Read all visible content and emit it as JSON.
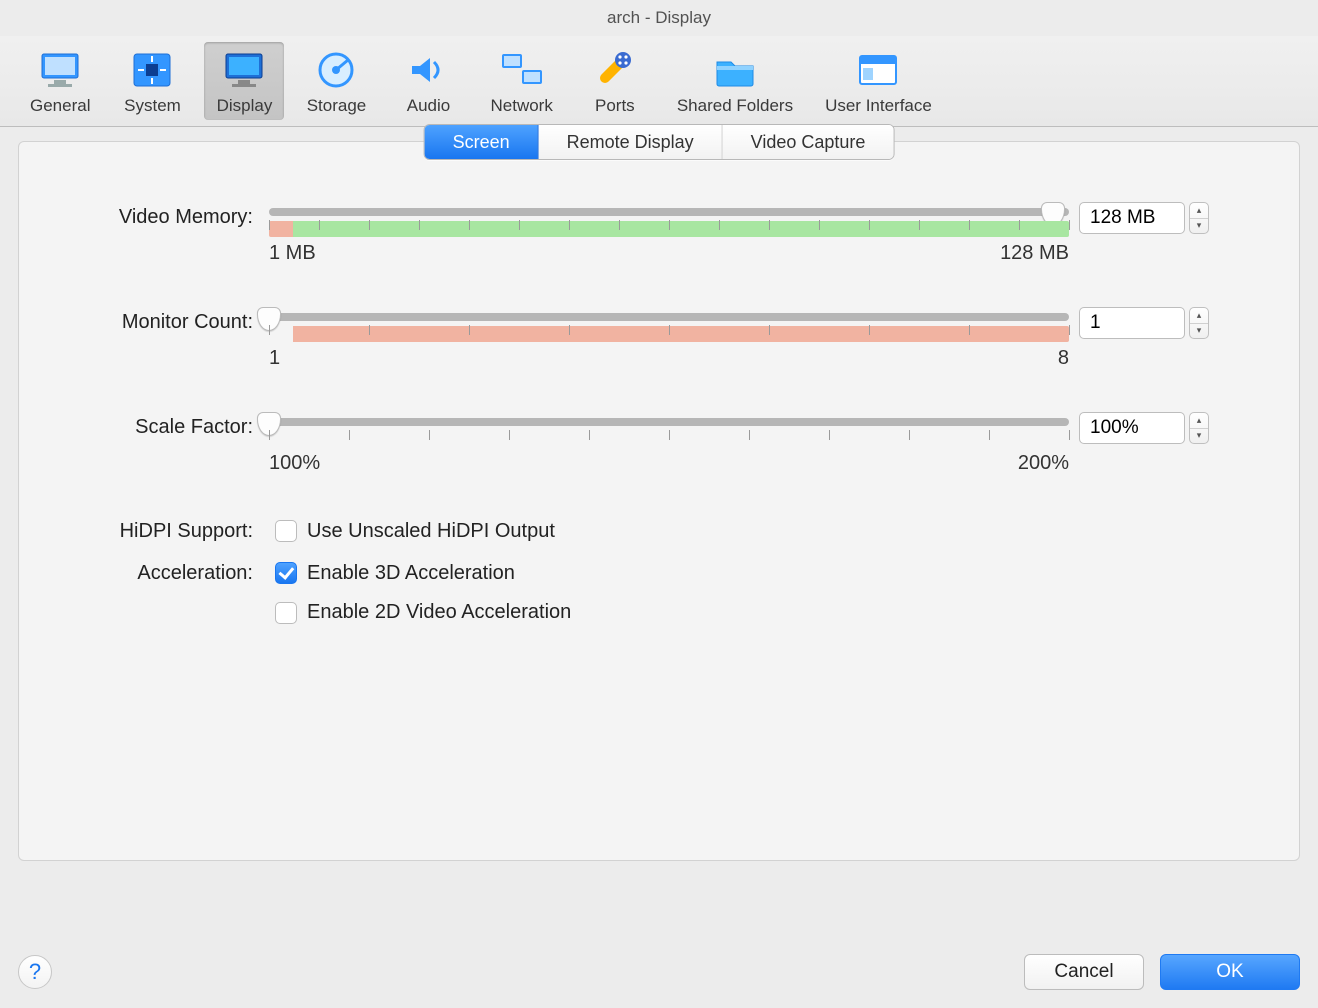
{
  "title": "arch - Display",
  "toolbar": [
    {
      "id": "general",
      "label": "General",
      "selected": false
    },
    {
      "id": "system",
      "label": "System",
      "selected": false
    },
    {
      "id": "display",
      "label": "Display",
      "selected": true
    },
    {
      "id": "storage",
      "label": "Storage",
      "selected": false
    },
    {
      "id": "audio",
      "label": "Audio",
      "selected": false
    },
    {
      "id": "network",
      "label": "Network",
      "selected": false
    },
    {
      "id": "ports",
      "label": "Ports",
      "selected": false
    },
    {
      "id": "shared",
      "label": "Shared Folders",
      "selected": false
    },
    {
      "id": "ui",
      "label": "User Interface",
      "selected": false
    }
  ],
  "tabs": {
    "screen": "Screen",
    "remote": "Remote Display",
    "capture": "Video Capture",
    "active": "screen"
  },
  "videoMemory": {
    "label": "Video Memory:",
    "minLabel": "1 MB",
    "maxLabel": "128 MB",
    "value": "128 MB",
    "percent": 98,
    "redTo": 3,
    "greenFrom": 3,
    "greenTo": 100
  },
  "monitorCount": {
    "label": "Monitor Count:",
    "minLabel": "1",
    "maxLabel": "8",
    "value": "1",
    "percent": 0,
    "redFrom": 3,
    "redTo": 100
  },
  "scaleFactor": {
    "label": "Scale Factor:",
    "minLabel": "100%",
    "maxLabel": "200%",
    "value": "100%",
    "percent": 0
  },
  "hidpi": {
    "label": "HiDPI Support:",
    "option": "Use Unscaled HiDPI Output",
    "checked": false
  },
  "accel": {
    "label": "Acceleration:",
    "opt3d": "Enable 3D Acceleration",
    "opt3dChecked": true,
    "opt2d": "Enable 2D Video Acceleration",
    "opt2dChecked": false
  },
  "buttons": {
    "help": "?",
    "cancel": "Cancel",
    "ok": "OK"
  }
}
